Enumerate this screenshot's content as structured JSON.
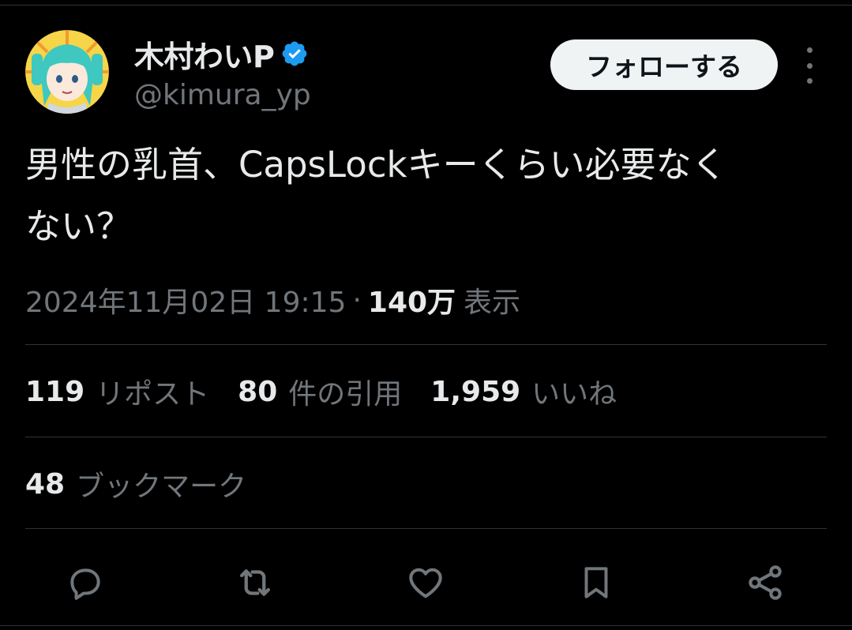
{
  "author": {
    "display_name": "木村わいP",
    "handle": "@kimura_yp",
    "verified_icon": "verified-badge-icon",
    "avatar_icon": "avatar-image"
  },
  "follow_button": {
    "label": "フォローする"
  },
  "more_button": {
    "icon": "more-vertical-icon"
  },
  "tweet": {
    "text": "男性の乳首、CapsLockキーくらい必要なく\nない？"
  },
  "meta": {
    "timestamp": "2024年11月02日 19:15",
    "separator": "·",
    "views_count": "140万",
    "views_label": "表示"
  },
  "stats": {
    "reposts": {
      "count": "119",
      "label": "リポスト"
    },
    "quotes": {
      "count": "80",
      "label": "件の引用"
    },
    "likes": {
      "count": "1,959",
      "label": "いいね"
    },
    "bookmarks": {
      "count": "48",
      "label": "ブックマーク"
    }
  },
  "actions": {
    "reply": "reply-icon",
    "repost": "repost-icon",
    "like": "heart-icon",
    "bookmark": "bookmark-icon",
    "share": "share-icon"
  },
  "colors": {
    "background": "#000000",
    "text_primary": "#e7e9ea",
    "text_secondary": "#71767b",
    "divider": "#2f3336",
    "verified_blue": "#1d9bf0",
    "follow_bg": "#eff3f4"
  }
}
